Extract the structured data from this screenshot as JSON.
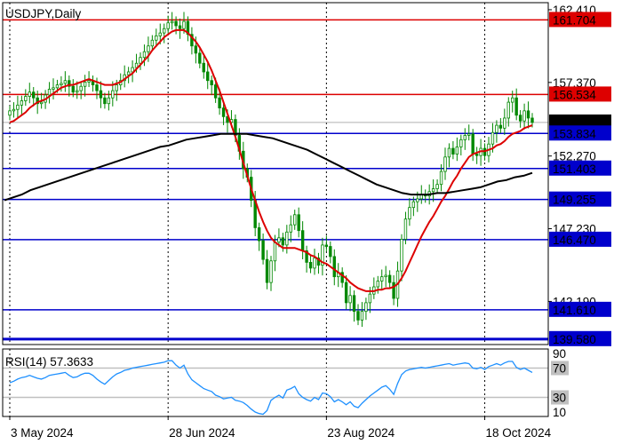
{
  "chart_data": {
    "type": "candlestick",
    "symbol": "USDJPY,Daily",
    "main_axis": {
      "ymin": 139.2,
      "ymax": 162.9,
      "tick_labels": [
        "162.410",
        "157.370",
        "152.270",
        "147.230",
        "142.190"
      ],
      "tick_values": [
        162.41,
        157.37,
        152.27,
        147.23,
        142.19
      ]
    },
    "levels": [
      {
        "label": "161.704",
        "value": 161.704,
        "color": "#dd0000",
        "text_color": "#ffffff"
      },
      {
        "label": "156.534",
        "value": 156.534,
        "color": "#dd0000",
        "text_color": "#ffffff"
      },
      {
        "label": "154.594",
        "value": 154.594,
        "color": "#000000",
        "text_color": "#ffffff",
        "is_current_price": true
      },
      {
        "label": "153.834",
        "value": 153.834,
        "color": "#0000cc",
        "text_color": "#ffffff"
      },
      {
        "label": "151.403",
        "value": 151.403,
        "color": "#0000cc",
        "text_color": "#ffffff"
      },
      {
        "label": "149.255",
        "value": 149.255,
        "color": "#0000cc",
        "text_color": "#ffffff"
      },
      {
        "label": "146.470",
        "value": 146.47,
        "color": "#0000cc",
        "text_color": "#ffffff"
      },
      {
        "label": "141.610",
        "value": 141.61,
        "color": "#0000cc",
        "text_color": "#ffffff"
      },
      {
        "label": "139.580",
        "value": 139.58,
        "color": "#0000cc",
        "text_color": "#ffffff"
      }
    ],
    "close": [
      155.4,
      155.5,
      155.8,
      156.1,
      156.4,
      156.7,
      156.3,
      155.9,
      156.0,
      156.5,
      156.9,
      157.0,
      157.2,
      157.3,
      157.5,
      157.1,
      156.7,
      156.8,
      157.1,
      157.4,
      157.5,
      157.2,
      156.8,
      156.3,
      155.9,
      156.3,
      156.8,
      157.2,
      157.5,
      157.9,
      158.1,
      158.4,
      158.7,
      159.1,
      159.5,
      159.9,
      160.3,
      160.6,
      160.8,
      161.1,
      161.5,
      161.6,
      161.3,
      161.1,
      161.6,
      160.7,
      159.9,
      159.4,
      158.7,
      158.1,
      157.5,
      157.2,
      156.3,
      155.6,
      155.0,
      154.6,
      154.8,
      153.7,
      152.6,
      151.4,
      150.8,
      149.2,
      147.3,
      146.4,
      145.1,
      143.5,
      145.0,
      146.3,
      146.6,
      146.1,
      147.0,
      147.5,
      148.2,
      147.1,
      145.7,
      144.9,
      144.5,
      145.2,
      144.7,
      146.1,
      146.0,
      145.3,
      143.9,
      144.2,
      143.5,
      142.1,
      142.6,
      141.5,
      140.9,
      141.5,
      142.1,
      142.7,
      143.2,
      143.6,
      143.9,
      144.0,
      143.5,
      142.4,
      144.3,
      146.5,
      147.9,
      148.7,
      149.1,
      149.3,
      149.6,
      149.5,
      149.8,
      150.0,
      150.3,
      151.2,
      152.2,
      152.8,
      152.4,
      152.9,
      153.4,
      153.7,
      153.8,
      152.4,
      152.3,
      152.8,
      152.3,
      153.1,
      153.9,
      154.4,
      154.2,
      154.9,
      156.0,
      156.3,
      155.1,
      154.7,
      155.4,
      154.9,
      154.6
    ],
    "ema_fast": [
      154.6,
      154.7,
      154.9,
      155.1,
      155.3,
      155.6,
      155.8,
      156.0,
      156.1,
      156.2,
      156.4,
      156.6,
      156.8,
      157.0,
      157.1,
      157.2,
      157.2,
      157.3,
      157.4,
      157.5,
      157.6,
      157.5,
      157.4,
      157.3,
      157.2,
      157.2,
      157.2,
      157.3,
      157.4,
      157.6,
      157.8,
      158.0,
      158.3,
      158.6,
      158.9,
      159.2,
      159.6,
      159.9,
      160.2,
      160.5,
      160.7,
      160.9,
      161.0,
      161.0,
      161.0,
      160.8,
      160.5,
      160.2,
      159.8,
      159.3,
      158.8,
      158.2,
      157.5,
      156.8,
      156.0,
      155.2,
      154.4,
      153.6,
      152.7,
      151.8,
      150.9,
      150.0,
      149.2,
      148.4,
      147.7,
      147.1,
      146.6,
      146.3,
      146.1,
      145.9,
      145.9,
      145.9,
      145.9,
      145.8,
      145.7,
      145.6,
      145.4,
      145.3,
      145.1,
      144.9,
      144.8,
      144.6,
      144.4,
      144.2,
      144.0,
      143.8,
      143.5,
      143.3,
      143.1,
      143.0,
      142.9,
      142.9,
      142.9,
      143.0,
      143.0,
      143.1,
      143.1,
      143.2,
      143.4,
      143.8,
      144.3,
      144.9,
      145.5,
      146.1,
      146.7,
      147.2,
      147.7,
      148.1,
      148.6,
      149.1,
      149.5,
      150.0,
      150.5,
      150.9,
      151.4,
      151.8,
      152.2,
      152.4,
      152.5,
      152.6,
      152.6,
      152.7,
      152.8,
      153.0,
      153.1,
      153.3,
      153.6,
      153.8,
      153.9,
      154.0,
      154.2,
      154.3,
      154.4
    ],
    "sma_slow": [
      149.2,
      149.4,
      149.6,
      149.9,
      150.1,
      150.3,
      150.5,
      150.7,
      150.9,
      151.1,
      151.3,
      151.5,
      151.7,
      151.9,
      152.1,
      152.3,
      152.5,
      152.7,
      152.9,
      153.0,
      153.2,
      153.4,
      153.5,
      153.6,
      153.7,
      153.8,
      153.8,
      153.8,
      153.8,
      153.7,
      153.6,
      153.5,
      153.3,
      153.1,
      152.9,
      152.7,
      152.4,
      152.1,
      151.8,
      151.5,
      151.2,
      150.9,
      150.6,
      150.3,
      150.1,
      149.9,
      149.7,
      149.6,
      149.6,
      149.6,
      149.7,
      149.7,
      149.8,
      149.9,
      150.0,
      150.1,
      150.3,
      150.5,
      150.6,
      150.8,
      150.9,
      151.1
    ],
    "rsi": {
      "label": "RSI(14) 57.3633",
      "period": 14,
      "current": 57.3633,
      "ymin": 4,
      "ymax": 96,
      "tick_labels": [
        "90",
        "70",
        "30",
        "10"
      ],
      "tick_values": [
        90,
        70,
        30,
        10
      ],
      "reference_levels": [
        70,
        30
      ],
      "values": [
        50,
        52,
        55,
        57,
        58,
        60,
        58,
        56,
        55,
        57,
        60,
        61,
        62,
        63,
        64,
        60,
        57,
        58,
        61,
        63,
        63,
        60,
        55,
        51,
        48,
        53,
        58,
        62,
        64,
        67,
        68,
        70,
        71,
        72,
        73,
        74,
        75,
        76,
        77,
        78,
        80,
        80,
        74,
        70,
        74,
        62,
        54,
        50,
        46,
        42,
        40,
        38,
        33,
        31,
        28,
        29,
        30,
        26,
        25,
        23,
        19,
        14,
        10,
        8,
        7,
        12,
        26,
        30,
        33,
        29,
        40,
        42,
        45,
        35,
        30,
        27,
        25,
        30,
        27,
        36,
        35,
        31,
        24,
        27,
        24,
        20,
        24,
        18,
        16,
        22,
        27,
        32,
        36,
        40,
        44,
        46,
        41,
        34,
        49,
        61,
        66,
        68,
        69,
        70,
        71,
        70,
        71,
        72,
        73,
        74,
        75,
        76,
        74,
        75,
        76,
        77,
        76,
        70,
        69,
        71,
        68,
        72,
        74,
        76,
        74,
        77,
        79,
        79,
        71,
        68,
        70,
        67,
        64
      ]
    },
    "x_axis_labels": [
      "3 May 2024",
      "28 Jun 2024",
      "23 Aug 2024",
      "18 Oct 2024"
    ],
    "x_axis_label_bars": [
      0,
      40,
      80,
      120
    ],
    "colors": {
      "bull": "#008800",
      "bear": "#008800",
      "ema_fast": "#dd0000",
      "sma_slow": "#000000",
      "rsi": "#1e90ff",
      "grid": "#000000"
    }
  }
}
